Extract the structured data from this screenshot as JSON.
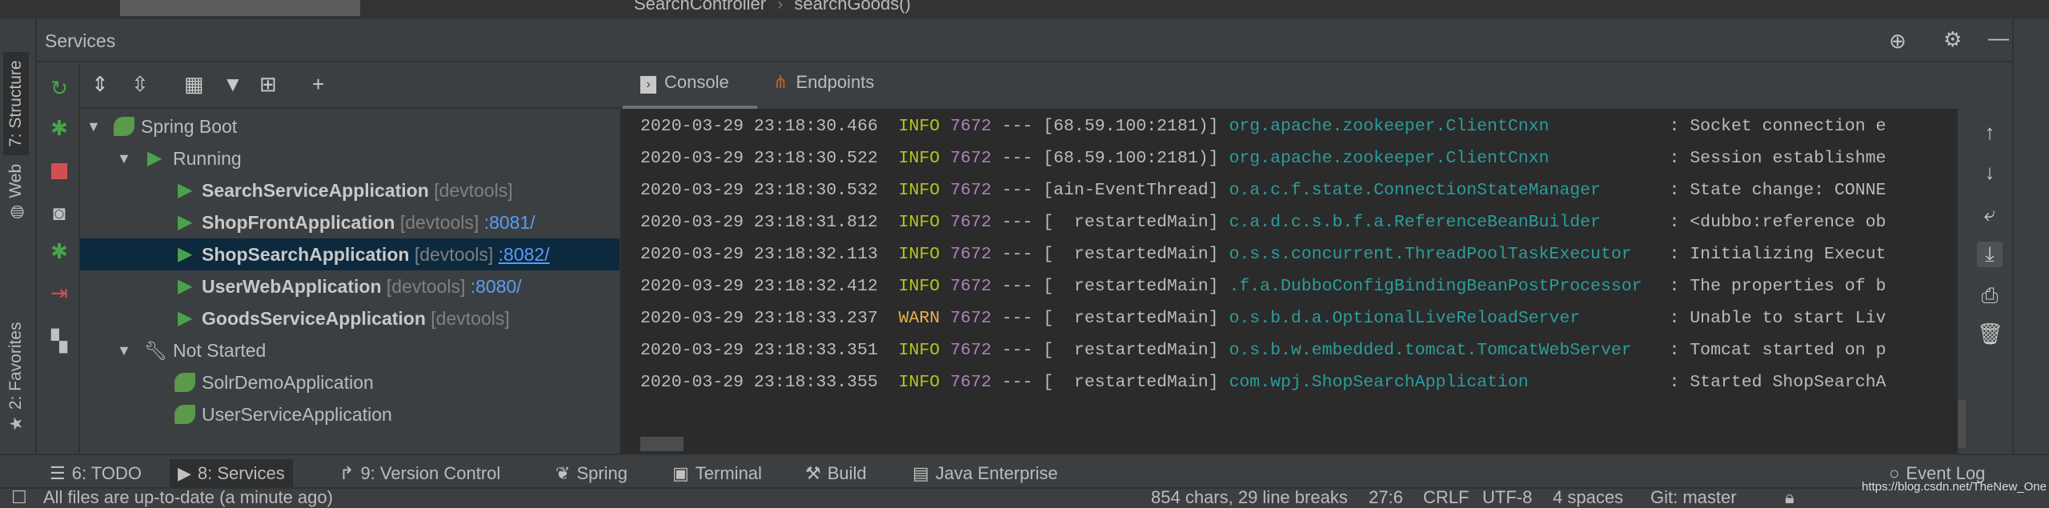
{
  "editor": {
    "breadcrumb": [
      "SearchController",
      "searchGoods()"
    ]
  },
  "left_tabs": [
    "7: Structure",
    "Web",
    "2: Favorites"
  ],
  "services": {
    "title": "Services",
    "tree": [
      {
        "label": "Spring Boot",
        "level": 0,
        "expanded": true
      },
      {
        "label": "Running",
        "level": 1,
        "expanded": true
      },
      {
        "label": "SearchServiceApplication",
        "tag": "[devtools]",
        "port": "",
        "level": 2
      },
      {
        "label": "ShopFrontApplication",
        "tag": "[devtools]",
        "port": ":8081/",
        "level": 2
      },
      {
        "label": "ShopSearchApplication",
        "tag": "[devtools]",
        "port": ":8082/",
        "level": 2,
        "selected": true
      },
      {
        "label": "UserWebApplication",
        "tag": "[devtools]",
        "port": ":8080/",
        "level": 2
      },
      {
        "label": "GoodsServiceApplication",
        "tag": "[devtools]",
        "port": "",
        "level": 2
      },
      {
        "label": "Not Started",
        "level": 1,
        "expanded": true
      },
      {
        "label": "SolrDemoApplication",
        "level": 2
      },
      {
        "label": "UserServiceApplication",
        "level": 2
      }
    ],
    "tabs": [
      {
        "label": "Console",
        "active": true
      },
      {
        "label": "Endpoints"
      }
    ]
  },
  "console": {
    "lines": [
      {
        "ts": "2020-03-29 23:18:30.466",
        "level": "INFO",
        "pid": "7672",
        "sep": "---",
        "thread": "[68.59.100:2181)]",
        "logger": "org.apache.zookeeper.ClientCnxn",
        "msg": ": Socket connection e"
      },
      {
        "ts": "2020-03-29 23:18:30.522",
        "level": "INFO",
        "pid": "7672",
        "sep": "---",
        "thread": "[68.59.100:2181)]",
        "logger": "org.apache.zookeeper.ClientCnxn",
        "msg": ": Session establishme"
      },
      {
        "ts": "2020-03-29 23:18:30.532",
        "level": "INFO",
        "pid": "7672",
        "sep": "---",
        "thread": "[ain-EventThread]",
        "logger": "o.a.c.f.state.ConnectionStateManager",
        "msg": ": State change: CONNE"
      },
      {
        "ts": "2020-03-29 23:18:31.812",
        "level": "INFO",
        "pid": "7672",
        "sep": "---",
        "thread": "[  restartedMain]",
        "logger": "c.a.d.c.s.b.f.a.ReferenceBeanBuilder",
        "msg": ": <dubbo:reference ob"
      },
      {
        "ts": "2020-03-29 23:18:32.113",
        "level": "INFO",
        "pid": "7672",
        "sep": "---",
        "thread": "[  restartedMain]",
        "logger": "o.s.s.concurrent.ThreadPoolTaskExecutor",
        "msg": ": Initializing Execut"
      },
      {
        "ts": "2020-03-29 23:18:32.412",
        "level": "INFO",
        "pid": "7672",
        "sep": "---",
        "thread": "[  restartedMain]",
        "logger": ".f.a.DubboConfigBindingBeanPostProcessor",
        "msg": ": The properties of b"
      },
      {
        "ts": "2020-03-29 23:18:33.237",
        "level": "WARN",
        "pid": "7672",
        "sep": "---",
        "thread": "[  restartedMain]",
        "logger": "o.s.b.d.a.OptionalLiveReloadServer",
        "msg": ": Unable to start Liv"
      },
      {
        "ts": "2020-03-29 23:18:33.351",
        "level": "INFO",
        "pid": "7672",
        "sep": "---",
        "thread": "[  restartedMain]",
        "logger": "o.s.b.w.embedded.tomcat.TomcatWebServer",
        "msg": ": Tomcat started on p"
      },
      {
        "ts": "2020-03-29 23:18:33.355",
        "level": "INFO",
        "pid": "7672",
        "sep": "---",
        "thread": "[  restartedMain]",
        "logger": "com.wpj.ShopSearchApplication",
        "msg": ": Started ShopSearchA"
      }
    ]
  },
  "bottom_tabs": [
    {
      "label": "6: TODO",
      "icon": "list-icon"
    },
    {
      "label": "8: Services",
      "icon": "services-icon",
      "active": true
    },
    {
      "label": "9: Version Control",
      "icon": "vcs-icon"
    },
    {
      "label": "Spring",
      "icon": "spring-leaf-icon"
    },
    {
      "label": "Terminal",
      "icon": "terminal-icon"
    },
    {
      "label": "Build",
      "icon": "hammer-icon"
    },
    {
      "label": "Java Enterprise",
      "icon": "java-enterprise-icon"
    }
  ],
  "event_log": "Event Log",
  "status": {
    "message": "All files are up-to-date (a minute ago)",
    "chars": "854 chars, 29 line breaks",
    "position": "27:6",
    "line_sep": "CRLF",
    "encoding": "UTF-8",
    "indent": "4 spaces",
    "git": "Git: master"
  },
  "watermark": "https://blog.csdn.net/TheNew_One",
  "colors": {
    "info": "#b5c21e",
    "warn": "#e6b04a",
    "pid": "#b07fc1",
    "logger": "#2a9d9d",
    "link": "#589df6",
    "selection": "#0d293e"
  }
}
